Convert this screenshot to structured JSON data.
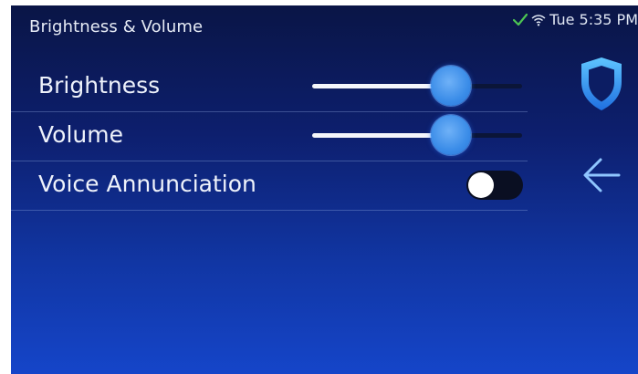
{
  "header": {
    "title": "Brightness & Volume"
  },
  "status": {
    "connection_icon": "check-icon",
    "wifi_icon": "wifi-icon",
    "datetime": "Tue 5:35 PM"
  },
  "settings": {
    "brightness": {
      "label": "Brightness",
      "level": 0.66
    },
    "volume": {
      "label": "Volume",
      "level": 0.66
    },
    "voice_annunciation": {
      "label": "Voice Annunciation",
      "enabled": false
    }
  },
  "side_nav": {
    "shield_icon": "shield-icon",
    "back_icon": "arrow-left-icon"
  },
  "colors": {
    "background_top": "#0a1546",
    "background_bottom": "#1545c9",
    "accent": "#3a8ce8",
    "check": "#4cc552"
  }
}
